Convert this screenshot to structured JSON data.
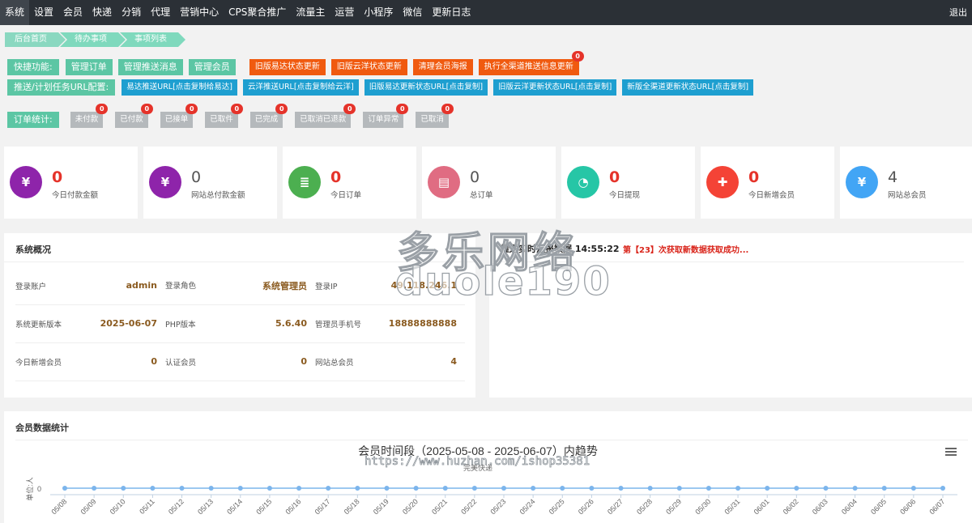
{
  "nav": {
    "items": [
      "系统",
      "设置",
      "会员",
      "快递",
      "分销",
      "代理",
      "营销中心",
      "CPS聚合推广",
      "流量主",
      "运营",
      "小程序",
      "微信",
      "更新日志"
    ],
    "logout": "退出"
  },
  "breadcrumb": [
    "后台首页",
    "待办事项",
    "事项列表"
  ],
  "quick": {
    "label": "快捷功能:",
    "green_buttons": [
      "管理订单",
      "管理推送消息",
      "管理会员"
    ],
    "orange_buttons": [
      {
        "label": "旧版易达状态更新",
        "badge": null
      },
      {
        "label": "旧版云洋状态更新",
        "badge": null
      },
      {
        "label": "清理会员海报",
        "badge": null
      },
      {
        "label": "执行全渠道推送信息更新",
        "badge": "0"
      }
    ]
  },
  "push_urls": {
    "label": "推送/计划任务URL配置:",
    "buttons": [
      "易达推送URL[点击复制给易达]",
      "云洋推送URL[点击复制给云洋]",
      "旧版易达更新状态URL[点击复制]",
      "旧版云洋更新状态URL[点击复制]",
      "新版全渠道更新状态URL[点击复制]"
    ]
  },
  "order_stats": {
    "label": "订单统计:",
    "items": [
      {
        "label": "未付款",
        "count": "0"
      },
      {
        "label": "已付款",
        "count": "0"
      },
      {
        "label": "已接单",
        "count": "0"
      },
      {
        "label": "已取件",
        "count": "0"
      },
      {
        "label": "已完成",
        "count": "0"
      },
      {
        "label": "已取消已退款",
        "count": "0"
      },
      {
        "label": "订单异常",
        "count": "0"
      },
      {
        "label": "已取消",
        "count": "0"
      }
    ]
  },
  "stat_cards": [
    {
      "value": "0",
      "caption": "今日付款金额",
      "icon": "yen-icon",
      "glyph": "¥",
      "color": "#8e24aa",
      "emphasis": "red"
    },
    {
      "value": "0",
      "caption": "网站总付款金额",
      "icon": "yen-icon",
      "glyph": "¥",
      "color": "#8e24aa",
      "emphasis": "gray"
    },
    {
      "value": "0",
      "caption": "今日订单",
      "icon": "document-icon",
      "glyph": "≣",
      "color": "#4caf50",
      "emphasis": "red"
    },
    {
      "value": "0",
      "caption": "总订单",
      "icon": "list-icon",
      "glyph": "▤",
      "color": "#e06c82",
      "emphasis": "gray"
    },
    {
      "value": "0",
      "caption": "今日提现",
      "icon": "pie-icon",
      "glyph": "◔",
      "color": "#26c6a6",
      "emphasis": "red"
    },
    {
      "value": "0",
      "caption": "今日新增会员",
      "icon": "add-user-icon",
      "glyph": "✚",
      "color": "#f44336",
      "emphasis": "red"
    },
    {
      "value": "4",
      "caption": "网站总会员",
      "icon": "money-bag-icon",
      "glyph": "¥",
      "color": "#42a5f5",
      "emphasis": "gray"
    }
  ],
  "system": {
    "title": "系统概况",
    "rows": [
      [
        {
          "k": "登录账户",
          "v": "admin"
        },
        {
          "k": "登录角色",
          "v": "系统管理员"
        },
        {
          "k": "登录IP",
          "v": "49.118.246.1"
        }
      ],
      [
        {
          "k": "系统更新版本",
          "v": "2025-06-07"
        },
        {
          "k": "PHP版本",
          "v": "5.6.40"
        },
        {
          "k": "管理员手机号",
          "v": "18888888888"
        }
      ],
      [
        {
          "k": "今日新增会员",
          "v": "0"
        },
        {
          "k": "认证会员",
          "v": "0"
        },
        {
          "k": "网站总会员",
          "v": "4"
        }
      ]
    ]
  },
  "push_report": {
    "title": "推送实时汇报数据 14:55:22",
    "message": "第【23】次获取新数据获取成功..."
  },
  "member_stats": {
    "title": "会员数据统计"
  },
  "watermark": {
    "line1": "多乐网络",
    "line2": "duole190",
    "line3": "https://www.huzhan.com/ishop35381"
  },
  "chart_data": {
    "type": "line",
    "title": "会员时间段（2025-05-08 - 2025-06-07）内趋势",
    "subtitle": "完美快递",
    "ylabel": "单位:人",
    "y_tick": "0",
    "categories": [
      "05/08",
      "05/09",
      "05/10",
      "05/11",
      "05/12",
      "05/13",
      "05/14",
      "05/15",
      "05/16",
      "05/17",
      "05/18",
      "05/19",
      "05/20",
      "05/21",
      "05/22",
      "05/23",
      "05/24",
      "05/25",
      "05/26",
      "05/27",
      "05/28",
      "05/29",
      "05/30",
      "05/31",
      "06/01",
      "06/02",
      "06/03",
      "06/04",
      "06/05",
      "06/06",
      "06/07"
    ],
    "values": [
      0,
      0,
      0,
      0,
      0,
      0,
      0,
      0,
      0,
      0,
      0,
      0,
      0,
      0,
      0,
      0,
      0,
      0,
      0,
      0,
      0,
      0,
      0,
      0,
      0,
      0,
      0,
      0,
      0,
      0,
      0
    ],
    "line_color": "#7cb5ec",
    "grid": false,
    "legend": "none"
  }
}
